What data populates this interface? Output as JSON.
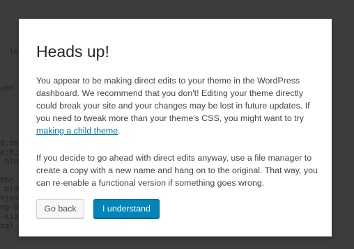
{
  "background_code": {
    "lines": [
      "",
      "",
      "",
      "",
      "",
      "  in a",
      "",
      "",
      "",
      "umn",
      "                                                                   , fe",
      "",
      "",
      "",
      "",
      "d,de                                                              ifram",
      "e:0;b                                                             ext-s",
      " blo                                                              ote{m",
      "",
      "thr",
      " blo                                                              ',Ari",
      "n}bo                                                              ed_na",
      "ng-b                                                              epeat",
      "-siz                                                              f2;te",
      "nal_padding{padding-bottom:1em}strong{font-weight:700}cite,em,i{font-sty",
      "",
      ""
    ]
  },
  "dialog": {
    "title": "Heads up!",
    "paragraph1_text": "You appear to be making direct edits to your theme in the WordPress dashboard. We recommend that you don't! Editing your theme directly could break your site and your changes may be lost in future updates. If you need to tweak more than your theme's CSS, you might want to try ",
    "paragraph1_link": "making a child theme",
    "paragraph1_end": ".",
    "paragraph2_text": "If you decide to go ahead with direct edits anyway, use a file manager to create a copy with a new name and hang on to the original. That way, you can re-enable a functional version if something goes wrong.",
    "go_back_label": "Go back",
    "understand_label": "I understand"
  },
  "colors": {
    "overlay": "#3c3c3c",
    "dialog_bg": "#ffffff",
    "primary_button": "#0085ba",
    "link": "#0073aa"
  }
}
